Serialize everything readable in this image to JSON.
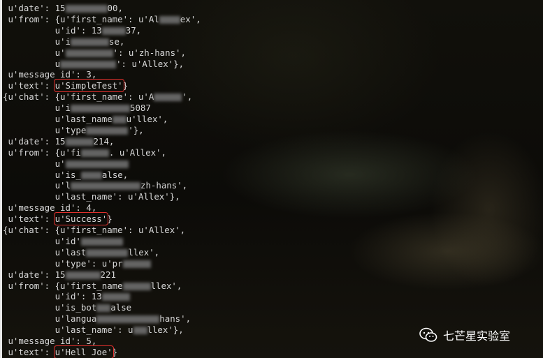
{
  "terminal": {
    "lines": [
      {
        "pre": " u'date': 15",
        "blur1w": 60,
        "mid": "00,"
      },
      {
        "pre": " u'from': {u'first_name': u'Al",
        "blur1w": 30,
        "mid": "ex',"
      },
      {
        "pre": "          u'id': 13",
        "blur1w": 34,
        "mid": "37,"
      },
      {
        "pre": "          u'i",
        "blur1w": 55,
        "mid": "se,"
      },
      {
        "pre": "          u'",
        "blur1w": 68,
        "mid": "': u'zh-hans',"
      },
      {
        "pre": "          u",
        "blur1w": 80,
        "mid": "': u'Allex'},"
      },
      {
        "pre": " u'message_id': 3,"
      },
      {
        "pre": " u'text': ",
        "hl": "u'SimpleTest'",
        "post": "}"
      },
      {
        "pre": "{u'chat': {u'first_name': u'A",
        "blur1w": 40,
        "mid": "',"
      },
      {
        "pre": "          u'i",
        "blur1w": 85,
        "mid": "5087"
      },
      {
        "pre": "          u'last_name",
        "blur1w": 20,
        "mid": "u'llex',"
      },
      {
        "pre": "          u'type",
        "blur1w": 60,
        "mid": "'},"
      },
      {
        "pre": " u'date': 15",
        "blur1w": 40,
        "mid": "214,"
      },
      {
        "pre": " u'from': {u'fi",
        "blur1w": 40,
        "mid": ". u'Allex',"
      },
      {
        "pre": "          u'",
        "blur1w": 90,
        "mid": ""
      },
      {
        "pre": "          u'is_",
        "blur1w": 30,
        "mid": "alse,"
      },
      {
        "pre": "          u'l",
        "blur1w": 100,
        "mid": "zh-hans',"
      },
      {
        "pre": "          u'last_name': u'Allex'},"
      },
      {
        "pre": " u'message_id': 4,"
      },
      {
        "pre": " u'text': ",
        "hl": "u'Success'",
        "post": "}"
      },
      {
        "pre": "{u'chat': {u'first_name': u'Allex',"
      },
      {
        "pre": "          u'id'",
        "blur1w": 60,
        "mid": ""
      },
      {
        "pre": "          u'last",
        "blur1w": 60,
        "mid": "llex',"
      },
      {
        "pre": "          u'type': u'pr",
        "blur1w": 40,
        "mid": ""
      },
      {
        "pre": " u'date': 15",
        "blur1w": 50,
        "mid": "221"
      },
      {
        "pre": " u'from': {u'first_name",
        "blur1w": 40,
        "mid": "llex',"
      },
      {
        "pre": "          u'id': 13",
        "blur1w": 40,
        "mid": ""
      },
      {
        "pre": "          u'is_bot",
        "blur1w": 20,
        "mid": "alse"
      },
      {
        "pre": "          u'langua",
        "blur1w": 90,
        "mid": "hans',"
      },
      {
        "pre": "          u'last_name': u",
        "blur1w": 20,
        "mid": "llex'},"
      },
      {
        "pre": " u'message_id': 5,"
      },
      {
        "pre": " u'text': ",
        "hl": "u'Hell Joe'",
        "post": "}"
      }
    ]
  },
  "watermark": {
    "text": "七芒星实验室",
    "icon": "wechat-icon"
  }
}
